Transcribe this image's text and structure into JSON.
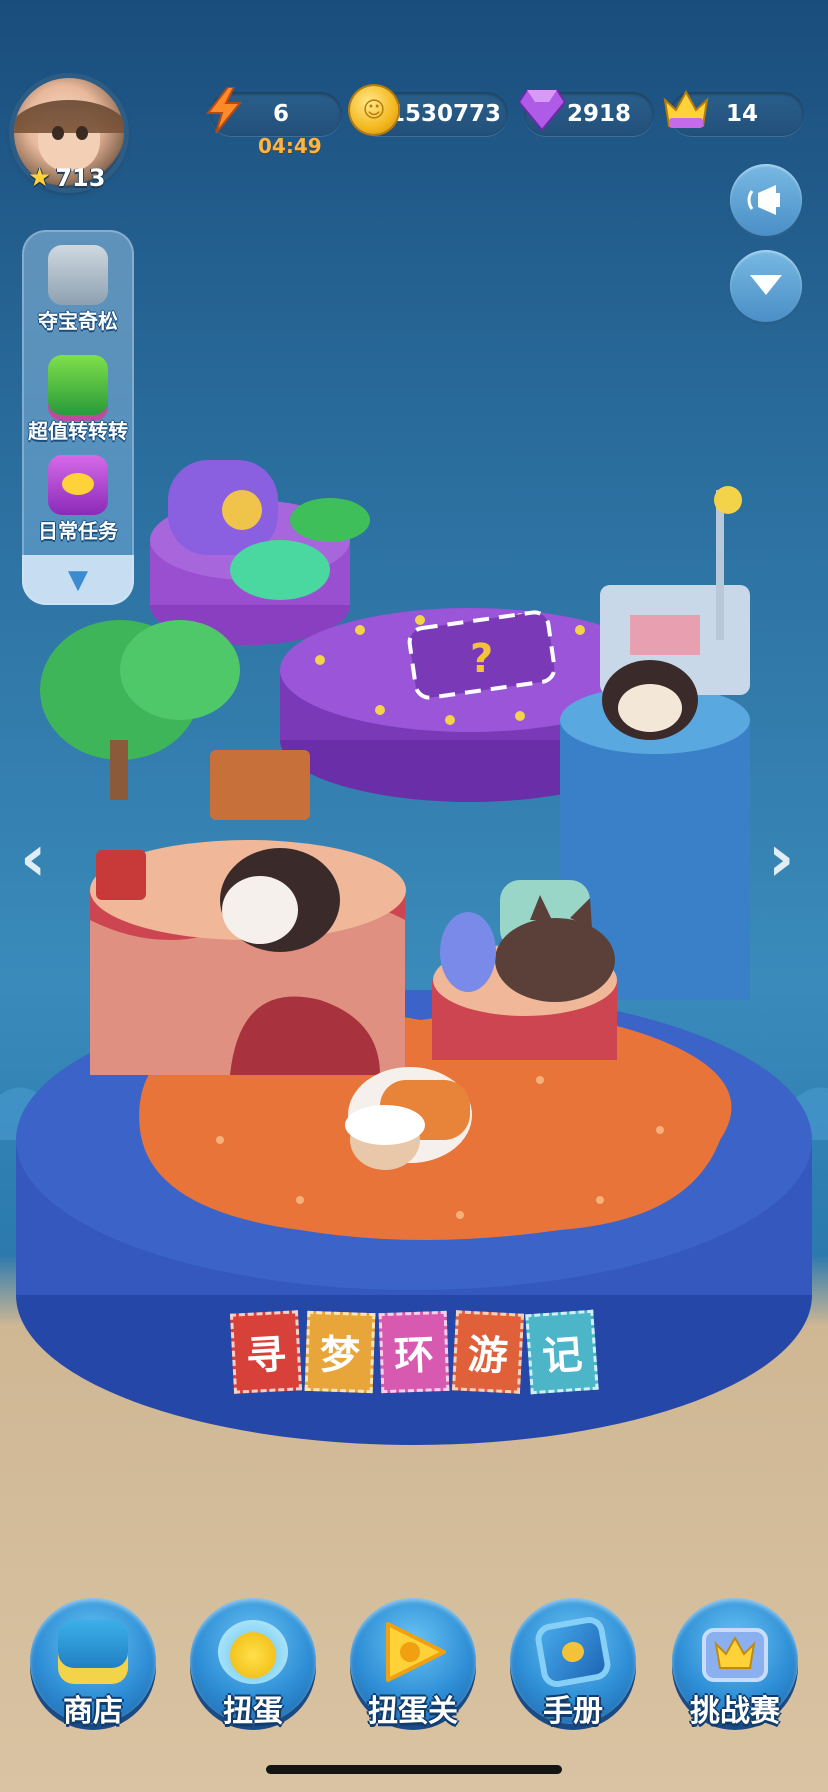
{
  "player": {
    "stars": "713"
  },
  "resources": {
    "energy": {
      "value": "6",
      "timer": "04:49",
      "icon": "lightning-icon"
    },
    "coins": {
      "value": "1530773",
      "icon": "coin-icon"
    },
    "gems": {
      "value": "2918",
      "icon": "gem-icon"
    },
    "crowns": {
      "value": "14",
      "icon": "crown-icon"
    }
  },
  "side_menu": [
    {
      "label": "夺宝奇松",
      "icon": "treasure-icon"
    },
    {
      "label": "超值转转转",
      "icon": "slot-machine-icon"
    },
    {
      "label": "日常任务",
      "icon": "daily-task-chest-icon"
    }
  ],
  "title_tiles": [
    "寻",
    "梦",
    "环",
    "游",
    "记"
  ],
  "bottom_nav": [
    {
      "label": "商店",
      "icon": "shop-icon"
    },
    {
      "label": "扭蛋",
      "icon": "gacha-icon"
    },
    {
      "label": "扭蛋关",
      "icon": "play-icon"
    },
    {
      "label": "手册",
      "icon": "handbook-icon"
    },
    {
      "label": "挑战赛",
      "icon": "challenge-crown-icon"
    }
  ],
  "colors": {
    "tile_colors": [
      "#d8403a",
      "#e8a53a",
      "#d85ab0",
      "#e0603a",
      "#4db5c8"
    ]
  }
}
